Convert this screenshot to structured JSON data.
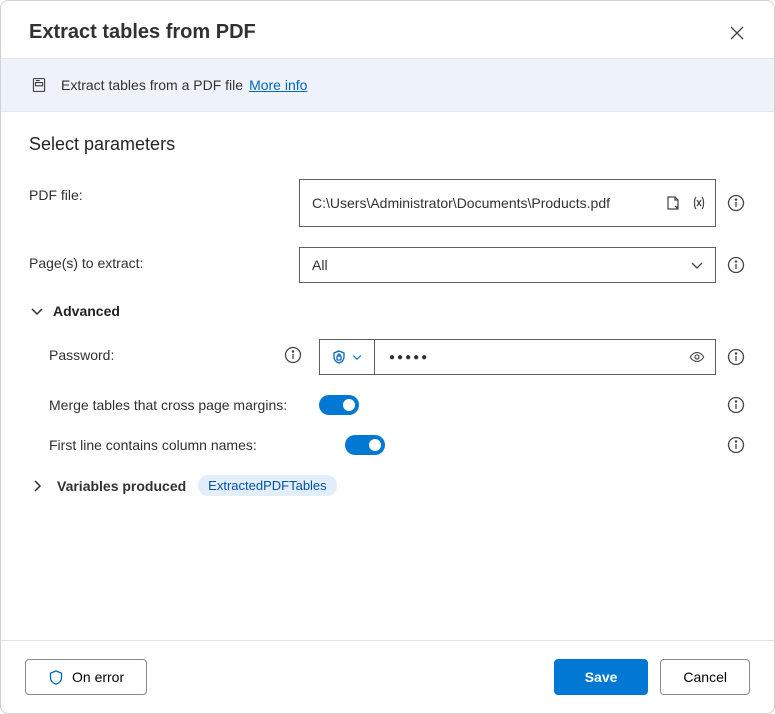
{
  "header": {
    "title": "Extract tables from PDF"
  },
  "infobar": {
    "text": "Extract tables from a PDF file",
    "link": "More info"
  },
  "section": {
    "title": "Select parameters"
  },
  "fields": {
    "pdf_label": "PDF file:",
    "pdf_value": "C:\\Users\\Administrator\\Documents\\Products.pdf",
    "pages_label": "Page(s) to extract:",
    "pages_value": "All",
    "advanced_label": "Advanced",
    "password_label": "Password:",
    "password_mask": "●●●●●",
    "merge_label": "Merge tables that cross page margins:",
    "firstline_label": "First line contains column names:",
    "vars_label": "Variables produced",
    "vars_chip": "ExtractedPDFTables"
  },
  "footer": {
    "onerror": "On error",
    "save": "Save",
    "cancel": "Cancel"
  }
}
